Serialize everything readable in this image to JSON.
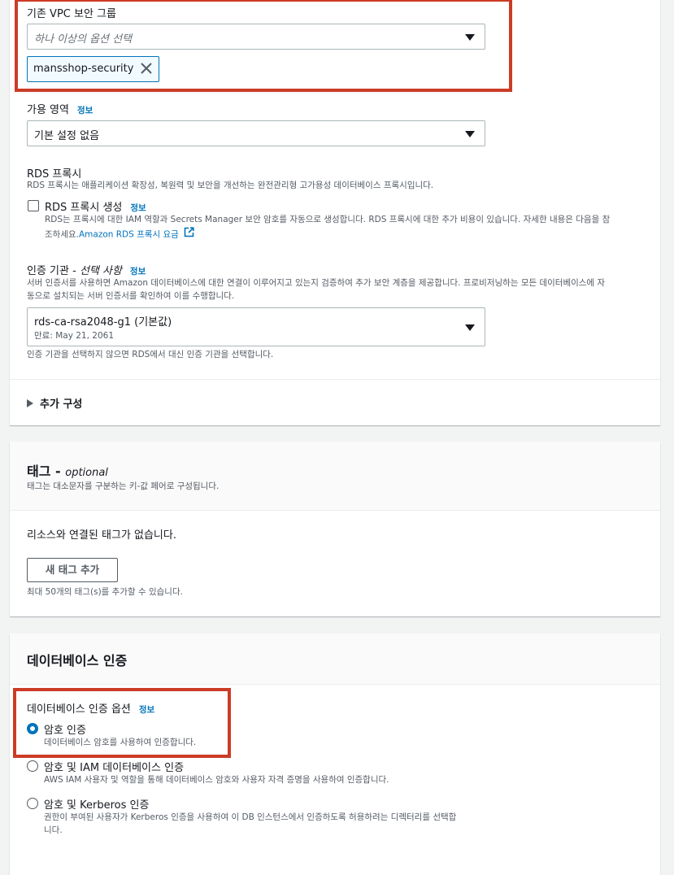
{
  "vpc": {
    "label": "기존 VPC 보안 그룹",
    "placeholder": "하나 이상의 옵션 선택",
    "token": "mansshop-security"
  },
  "az": {
    "label": "가용 영역",
    "info": "정보",
    "value": "기본 설정 없음"
  },
  "proxy": {
    "title": "RDS 프록시",
    "desc": "RDS 프록시는 애플리케이션 확장성, 복원력 및 보안을 개선하는 완전관리형 고가용성 데이터베이스 프록시입니다.",
    "checkbox_label": "RDS 프록시 생성",
    "info": "정보",
    "help_line1": "RDS는 프록시에 대한 IAM 역할과 Secrets Manager 보안 암호를 자동으로 생성합니다. RDS 프록시에 대한 추가 비용이 있습니다. 자세한 내용은 다음을 참",
    "help_line2": "조하세요.",
    "link": "Amazon RDS 프록시 요금"
  },
  "ca": {
    "label": "인증 기관 -",
    "label_italic": "선택 사항",
    "info": "정보",
    "desc_line1": "서버 인증서를 사용하면 Amazon 데이터베이스에 대한 연결이 이루어지고 있는지 검증하여 추가 보안 계층을 제공합니다. 프로비저닝하는 모든 데이터베이스에 자",
    "desc_line2": "동으로 설치되는 서버 인증서를 확인하여 이를 수행합니다.",
    "value": "rds-ca-rsa2048-g1 (기본값)",
    "expiry": "만료: May 21, 2061",
    "footnote": "인증 기관을 선택하지 않으면 RDS에서 대신 인증 기관을 선택합니다."
  },
  "additional": {
    "label": "추가 구성"
  },
  "tags": {
    "title": "태그 -",
    "title_optional": "optional",
    "desc": "태그는 대소문자를 구분하는 키-값 페어로 구성됩니다.",
    "empty": "리소스와 연결된 태그가 없습니다.",
    "add_button": "새 태그 추가",
    "limit": "최대 50개의 태그(s)를 추가할 수 있습니다."
  },
  "dbauth": {
    "title": "데이터베이스 인증",
    "options_label": "데이터베이스 인증 옵션",
    "info": "정보",
    "options": [
      {
        "label": "암호 인증",
        "desc": "데이터베이스 암호를 사용하여 인증합니다.",
        "selected": true
      },
      {
        "label": "암호 및 IAM 데이터베이스 인증",
        "desc": "AWS IAM 사용자 및 역할을 통해 데이터베이스 암호와 사용자 자격 증명을 사용하여 인증합니다.",
        "selected": false
      },
      {
        "label": "암호 및 Kerberos 인증",
        "desc": "권한이 부여된 사용자가 Kerberos 인증을 사용하여 이 DB 인스턴스에서 인증하도록 허용하려는 디렉터리를 선택합",
        "desc2": "니다.",
        "selected": false
      }
    ]
  },
  "colors": {
    "accent": "#0073bb",
    "highlight": "#cc3b26"
  }
}
